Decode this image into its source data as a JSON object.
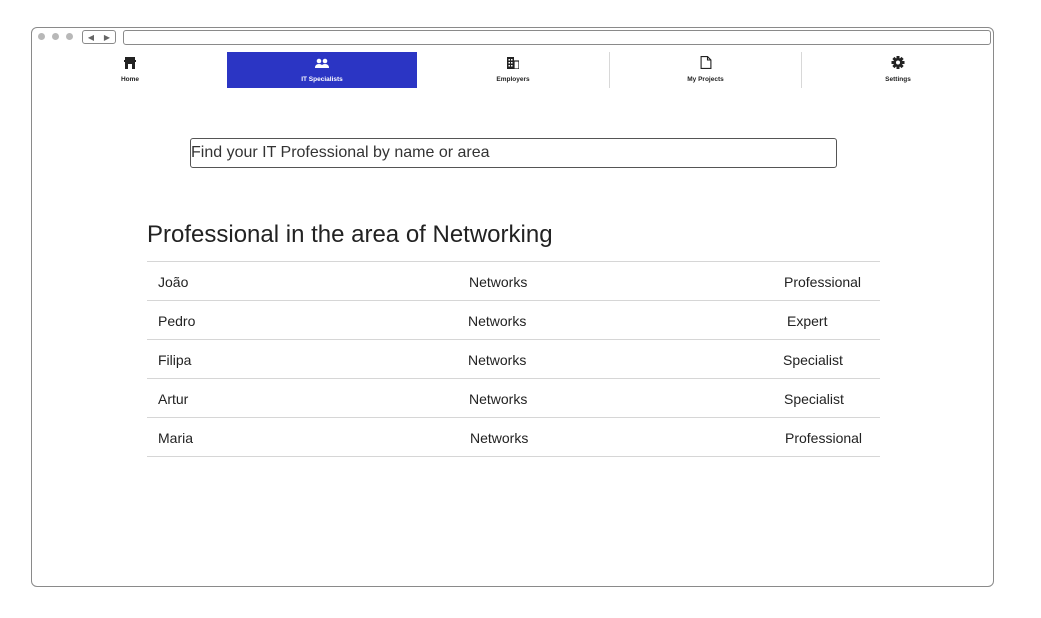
{
  "nav": {
    "tabs": [
      {
        "label": "Home",
        "icon": "home-icon",
        "active": false
      },
      {
        "label": "IT Specialists",
        "icon": "people-icon",
        "active": true
      },
      {
        "label": "Employers",
        "icon": "building-icon",
        "active": false
      },
      {
        "label": "My Projects",
        "icon": "document-icon",
        "active": false
      },
      {
        "label": "Settings",
        "icon": "gear-icon",
        "active": false
      }
    ],
    "active_color": "#2b35c4"
  },
  "search": {
    "text": "Find your IT Professional by name or area"
  },
  "section": {
    "title": "Professional in the area of Networking"
  },
  "professionals": [
    {
      "name": "João",
      "area": "Networks",
      "level": "Professional"
    },
    {
      "name": "Pedro",
      "area": "Networks",
      "level": "Expert"
    },
    {
      "name": "Filipa",
      "area": "Networks",
      "level": "Specialist"
    },
    {
      "name": "Artur",
      "area": "Networks",
      "level": "Specialist"
    },
    {
      "name": "Maria",
      "area": "Networks",
      "level": "Professional"
    }
  ]
}
